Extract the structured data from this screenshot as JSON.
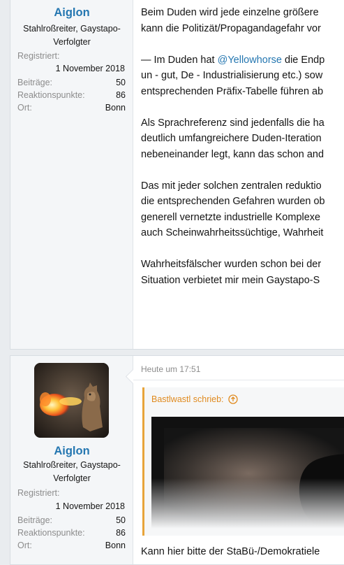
{
  "post1": {
    "user": {
      "name": "Aiglon",
      "title": "Stahlroßreiter, Gaystapo-Verfolgter",
      "registered_label": "Registriert:",
      "registered_value": "1 November 2018",
      "stats": [
        {
          "key": "Beiträge:",
          "value": "50"
        },
        {
          "key": "Reaktionspunkte:",
          "value": "86"
        },
        {
          "key": "Ort:",
          "value": "Bonn"
        }
      ]
    },
    "body": {
      "line1": "Beim Duden wird jede einzelne größere",
      "line2": "kann die Politizät/Propagandagefahr vor",
      "line3_pre": "— Im Duden hat ",
      "line3_mention": "@Yellowhorse",
      "line3_post": " die Endp",
      "line4": "un - gut, De - Industrialisierung etc.) sow",
      "line5": "entsprechenden Präfix-Tabelle führen ab",
      "line6": "Als Sprachreferenz sind jedenfalls die ha",
      "line7": "deutlich umfangreichere Duden-Iteration",
      "line8": "nebeneinander legt, kann das schon and",
      "line9": "Das mit jeder solchen zentralen reduktio",
      "line10": "die entsprechenden Gefahren wurden ob",
      "line11": "generell vernetzte industrielle Komplexe",
      "line12": "auch Scheinwahrheitssüchtige, Wahrheit",
      "line13": "Wahrheitsfälscher wurden schon bei der",
      "line14": "Situation verbietet mir mein Gaystapo-S"
    }
  },
  "post2": {
    "user": {
      "name": "Aiglon",
      "title_line1": "Stahlroßreiter, Gaystapo-",
      "title_line2": "Verfolgter",
      "registered_label": "Registriert:",
      "registered_value": "1 November 2018",
      "stats": [
        {
          "key": "Beiträge:",
          "value": "50"
        },
        {
          "key": "Reaktionspunkte:",
          "value": "86"
        },
        {
          "key": "Ort:",
          "value": "Bonn"
        }
      ]
    },
    "timestamp": "Heute um 17:51",
    "quote": {
      "author": "Bastlwastl schrieb:",
      "icon": "arrow-up-circle-icon"
    },
    "reply": "Kann hier bitte der StaBü-/Demokratiele"
  },
  "colors": {
    "username": "#2577b1",
    "quote_accent": "#e8a43a"
  }
}
